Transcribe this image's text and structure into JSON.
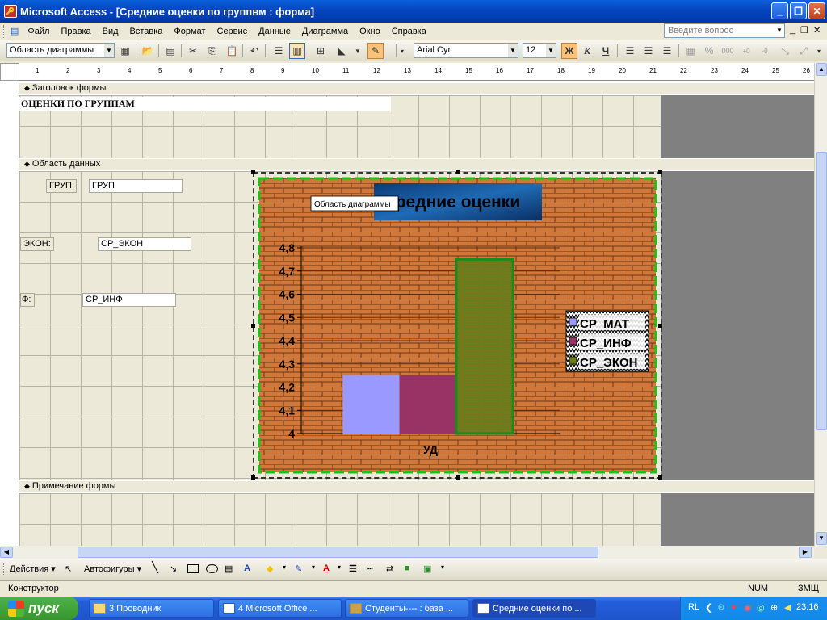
{
  "window": {
    "title": "Microsoft Access - [Средние оценки по группвм : форма]"
  },
  "menu": {
    "items": [
      "Файл",
      "Правка",
      "Вид",
      "Вставка",
      "Формат",
      "Сервис",
      "Данные",
      "Диаграмма",
      "Окно",
      "Справка"
    ],
    "help_placeholder": "Введите вопрос"
  },
  "toolbar": {
    "object_combo": "Область диаграммы",
    "font_combo": "Arial Cyr",
    "size_combo": "12",
    "bold": "Ж",
    "italic": "К",
    "underline": "Ч"
  },
  "ruler": {
    "ticks": [
      "1",
      "2",
      "3",
      "4",
      "5",
      "6",
      "7",
      "8",
      "9",
      "10",
      "11",
      "12",
      "13",
      "14",
      "15",
      "16",
      "17",
      "18",
      "19",
      "20",
      "21",
      "22",
      "23",
      "24",
      "25",
      "26",
      "27"
    ]
  },
  "sections": {
    "header": "Заголовок формы",
    "detail": "Область данных",
    "footer": "Примечание формы"
  },
  "form": {
    "title": "ОЦЕНКИ ПО ГРУППАМ",
    "controls": {
      "group_label": "ГРУП:",
      "group_field": "ГРУП",
      "econ_label": "ЭКОН:",
      "econ_field": "СР_ЭКОН",
      "inf_label": "Ф:",
      "inf_field": "СР_ИНФ"
    }
  },
  "chart_data": {
    "type": "bar",
    "title": "редние оценки",
    "tooltip": "Область диаграммы",
    "xlabel": "УД",
    "ylabel": "",
    "ylim": [
      4,
      4.8
    ],
    "yticks": [
      "4",
      "4,1",
      "4,2",
      "4,3",
      "4,4",
      "4,5",
      "4,6",
      "4,7",
      "4,8"
    ],
    "categories": [
      ""
    ],
    "series": [
      {
        "name": "СР_МАТ",
        "values": [
          4.25
        ],
        "color": "#9999ff"
      },
      {
        "name": "СР_ИНФ",
        "values": [
          4.25
        ],
        "color": "#993366"
      },
      {
        "name": "СР_ЭКОН",
        "values": [
          4.75
        ],
        "color": "#6b7d1a"
      }
    ],
    "legend": "right",
    "grid": true,
    "background": "brick-orange"
  },
  "drawbar": {
    "actions": "Действия",
    "autoshapes": "Автофигуры"
  },
  "status": {
    "mode": "Конструктор",
    "num": "NUM",
    "caps": "ЗМЩ"
  },
  "taskbar": {
    "start": "пуск",
    "tasks": [
      "3 Проводник",
      "4 Microsoft Office ...",
      "Студенты---- : база ...",
      "Средние оценки по ..."
    ],
    "lang": "RL",
    "clock": "23:16"
  }
}
